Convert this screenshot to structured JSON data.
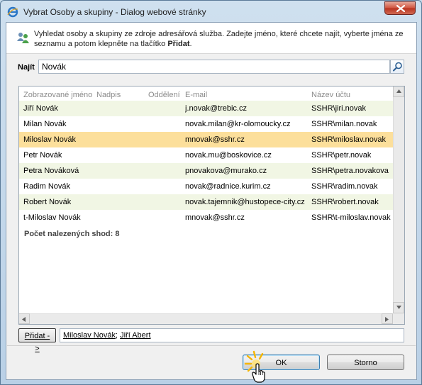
{
  "window": {
    "title": "Vybrat Osoby a skupiny - Dialog webové stránky"
  },
  "info": {
    "text_before": "Vyhledat osoby a skupiny ze zdroje adresářová služba. Zadejte jméno, které chcete najít, vyberte jména ze seznamu a potom klepněte na tlačítko ",
    "text_bold": "Přidat",
    "text_after": "."
  },
  "search": {
    "label": "Najít",
    "value": "Novák"
  },
  "table": {
    "columns": [
      "Zobrazované jméno",
      "Nadpis",
      "Oddělení",
      "E-mail",
      "Název účtu"
    ],
    "rows": [
      {
        "name": "Jiří Novák",
        "title": "",
        "department": "",
        "email": "j.novak@trebic.cz",
        "account": "SSHR\\jiri.novak"
      },
      {
        "name": "Milan Novák",
        "title": "",
        "department": "",
        "email": "novak.milan@kr-olomoucky.cz",
        "account": "SSHR\\milan.novak"
      },
      {
        "name": "Miloslav Novák",
        "title": "",
        "department": "",
        "email": "mnovak@sshr.cz",
        "account": "SSHR\\miloslav.novak"
      },
      {
        "name": "Petr Novák",
        "title": "",
        "department": "",
        "email": "novak.mu@boskovice.cz",
        "account": "SSHR\\petr.novak"
      },
      {
        "name": "Petra Nováková",
        "title": "",
        "department": "",
        "email": "pnovakova@murako.cz",
        "account": "SSHR\\petra.novakova"
      },
      {
        "name": "Radim Novák",
        "title": "",
        "department": "",
        "email": "novak@radnice.kurim.cz",
        "account": "SSHR\\radim.novak"
      },
      {
        "name": "Robert Novák",
        "title": "",
        "department": "",
        "email": "novak.tajemnik@hustopece-city.cz",
        "account": "SSHR\\robert.novak"
      },
      {
        "name": "t-Miloslav Novák",
        "title": "",
        "department": "",
        "email": "mnovak@sshr.cz",
        "account": "SSHR\\t-miloslav.novak"
      }
    ],
    "selected_row": 2,
    "count_text": "Počet nalezených shod: 8"
  },
  "add": {
    "button_label": "Přidat ->",
    "selected_names": [
      "Miloslav Novák",
      "Jiří Abert"
    ],
    "separator": "; "
  },
  "buttons": {
    "ok": "OK",
    "cancel": "Storno"
  },
  "colors": {
    "selected_row": "#fcdf9b",
    "alt_row": "#f1f6e4",
    "close_button": "#c8422c"
  },
  "icons": {
    "title": "ie-icon",
    "close": "close-icon",
    "info": "people-icon",
    "search": "search-icon"
  }
}
